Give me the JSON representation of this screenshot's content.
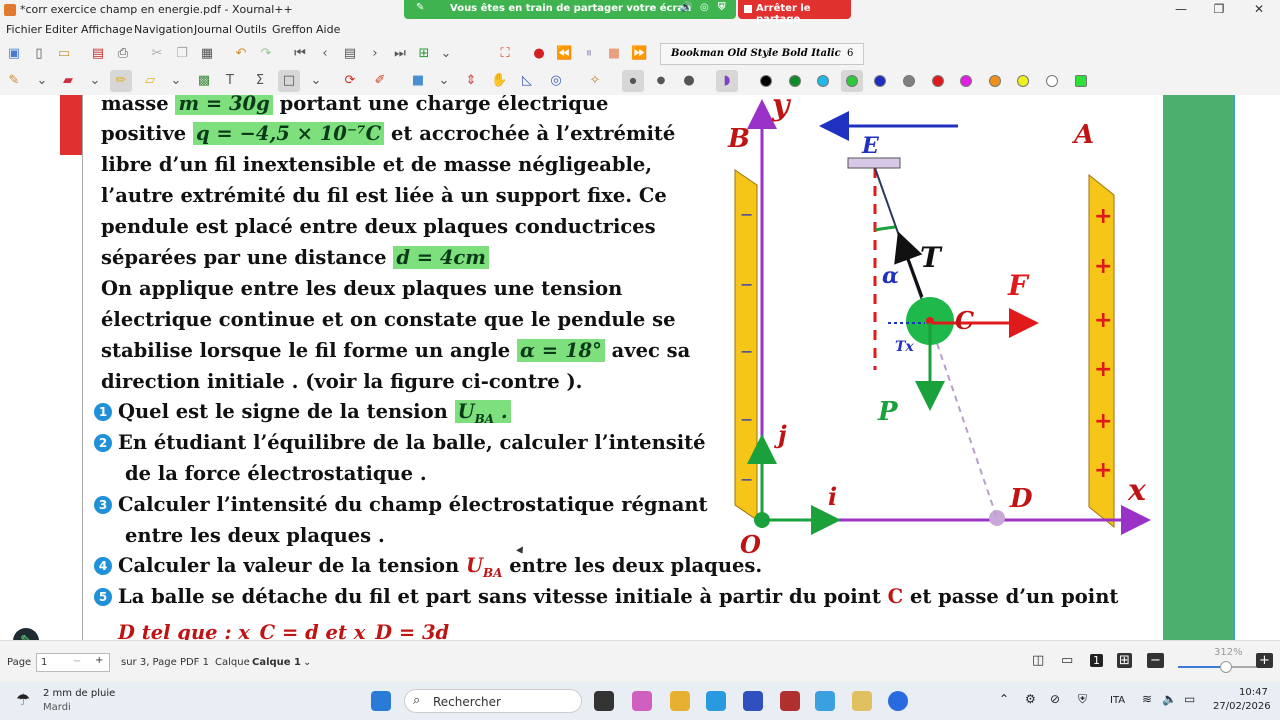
{
  "window": {
    "title": "*corr exercice champ en energie.pdf - Xournal++",
    "share_banner": "Vous êtes en train de partager votre écran",
    "stop_share": "Arrêter le partage"
  },
  "menu": [
    "Fichier",
    "Editer",
    "Affichage",
    "Navigation",
    "Journal",
    "Outils",
    "Greffon",
    "Aide"
  ],
  "toolbar": {
    "font_name": "Bookman Old Style Bold Italic",
    "font_size": "6"
  },
  "colors": {
    "palette": [
      "#000000",
      "#138a28",
      "#20b8e8",
      "#2dc93a",
      "#1c2fc0",
      "#808080",
      "#e01a1a",
      "#e020e0",
      "#f0901a",
      "#f0f020",
      "#ffffff",
      "#2fe03a"
    ],
    "highlight": "#7de07d",
    "accent_red": "#c01414",
    "plate_yellow": "#f5c518"
  },
  "document": {
    "line1_a": "masse",
    "line1_hl": "m = 30g",
    "line1_b": "portant une charge électrique",
    "line2_a": "positive",
    "line2_hl": "q = −4,5 × 10⁻⁷C",
    "line2_b": "et accrochée à l’extrémité",
    "line3": "libre d’un fil inextensible et de masse négligeable,",
    "line4": "l’autre extrémité du fil est liée à un support fixe. Ce",
    "line5": "pendule est placé entre deux plaques conductrices",
    "line6_a": "séparées par une distance",
    "line6_hl": "d = 4cm",
    "line7": "On applique entre les deux plaques une tension",
    "line8": "électrique continue et on constate que le pendule se",
    "line9_a": "stabilise lorsque le fil forme un angle",
    "line9_hl": "α = 18°",
    "line9_b": "avec sa",
    "line10": "direction initiale . (voir la figure ci-contre  ).",
    "q1_num": "1",
    "q1_a": "Quel est le signe de la tension",
    "q1_hl": "U",
    "q1_sub": "BA",
    "q1_end": ".",
    "q2_num": "2",
    "q2_a": "En étudiant l’équilibre de la balle, calculer l’intensité",
    "q2_b": "de la force électrostatique .",
    "q3_num": "3",
    "q3_a": "Calculer l’intensité du champ électrostatique régnant",
    "q3_b": "entre les deux plaques .",
    "q4_num": "4",
    "q4_a": "Calculer la valeur de la tension",
    "q4_u": "U",
    "q4_sub": "BA",
    "q4_b": "entre les deux plaques.",
    "q5_num": "5",
    "q5_a": "La balle se détache du fil et part sans vitesse initiale à partir du point",
    "q5_c": "C",
    "q5_b": "et passe d’un point",
    "q5_line2": "D tel que : x_C = d   et  x_D = 3d"
  },
  "figure": {
    "label_B": "B",
    "label_A": "A",
    "label_y": "y",
    "label_x": "x",
    "label_O": "O",
    "label_C": "C",
    "label_D": "D",
    "label_i": "i",
    "label_j": "j",
    "label_E": "E",
    "label_F": "F",
    "label_T": "T",
    "label_P": "P",
    "label_alpha": "α",
    "label_Tx": "Tx",
    "minus": "−",
    "plus": "+"
  },
  "status": {
    "page_label": "Page",
    "page_value": "1",
    "page_of": "sur 3, Page PDF 1",
    "layer_label": "Calque",
    "layer_value": "Calque 1",
    "zoom": "312%",
    "zoom_fraction": 0.62
  },
  "taskbar": {
    "weather": "2 mm de pluie",
    "weather_day": "Mardi",
    "search": "Rechercher",
    "lang": "ITA",
    "time": "10:47",
    "date": "27/02/2026"
  }
}
